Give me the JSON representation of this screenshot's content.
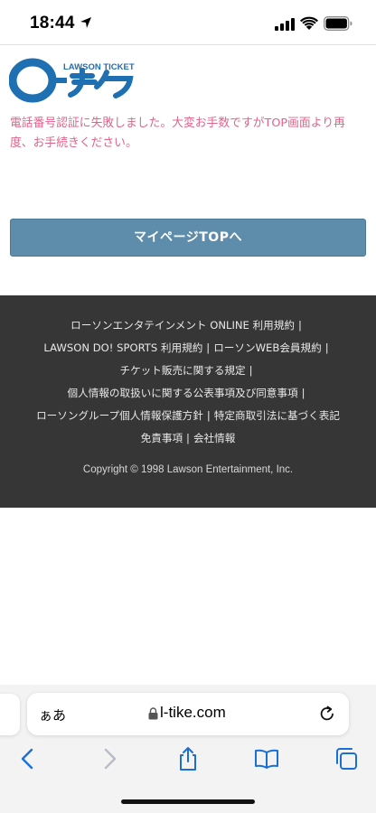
{
  "status_bar": {
    "time": "18:44"
  },
  "logo": {
    "subtitle": "LAWSON TICKET",
    "brand": "ローチケ",
    "brand_color": "#1f6fb3"
  },
  "error": {
    "message": "電話番号認証に失敗しました。大変お手数ですがTOP画面より再度、お手続きください。",
    "color": "#e0638a"
  },
  "button": {
    "label": "マイページTOPへ",
    "color": "#5e8cab"
  },
  "footer": {
    "links": [
      "ローソンエンタテインメント ONLINE 利用規約",
      "LAWSON DO! SPORTS 利用規約",
      "ローソンWEB会員規約",
      "チケット販売に関する規定",
      "個人情報の取扱いに関する公表事項及び同意事項",
      "ローソングループ個人情報保護方針",
      "特定商取引法に基づく表記",
      "免責事項",
      "会社情報"
    ],
    "separator": "|",
    "copyright": "Copyright © 1998 Lawson Entertainment, Inc.",
    "background": "#363636"
  },
  "browser": {
    "aa_label": "ぁあ",
    "url": "l-tike.com",
    "toolbar_color": "#1a6fd6",
    "toolbar": [
      "back-icon",
      "forward-icon",
      "share-icon",
      "bookmarks-icon",
      "tabs-icon"
    ]
  }
}
